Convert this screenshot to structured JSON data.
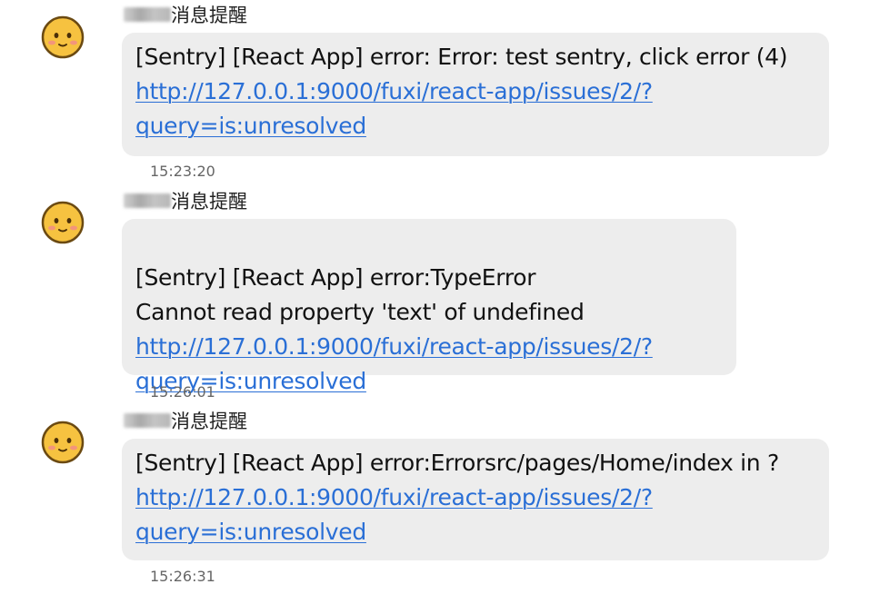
{
  "messages": [
    {
      "sender": "消息提醒",
      "text_before_link": "[Sentry] [React App] error: Error: test sentry, click error (4) ",
      "link": "http://127.0.0.1:9000/fuxi/react-app/issues/2/?query=is:unresolved",
      "time": "15:23:20"
    },
    {
      "sender": "消息提醒",
      "text_before_link": "[Sentry] [React App] error:TypeError\nCannot read property 'text' of undefined ",
      "link": "http://127.0.0.1:9000/fuxi/react-app/issues/2/?query=is:unresolved",
      "time": "15:26:01"
    },
    {
      "sender": "消息提醒",
      "text_before_link": "[Sentry] [React App] error:Errorsrc/pages/Home/index in ? ",
      "link": "http://127.0.0.1:9000/fuxi/react-app/issues/2/?query=is:unresolved",
      "time": "15:26:31"
    }
  ],
  "avatar_icon": "smiley-face-icon",
  "colors": {
    "bubble": "#ededed",
    "link": "#2a6fd6",
    "timestamp": "#666666",
    "avatar_face": "#f6c240",
    "avatar_outline": "#6b4a12"
  }
}
